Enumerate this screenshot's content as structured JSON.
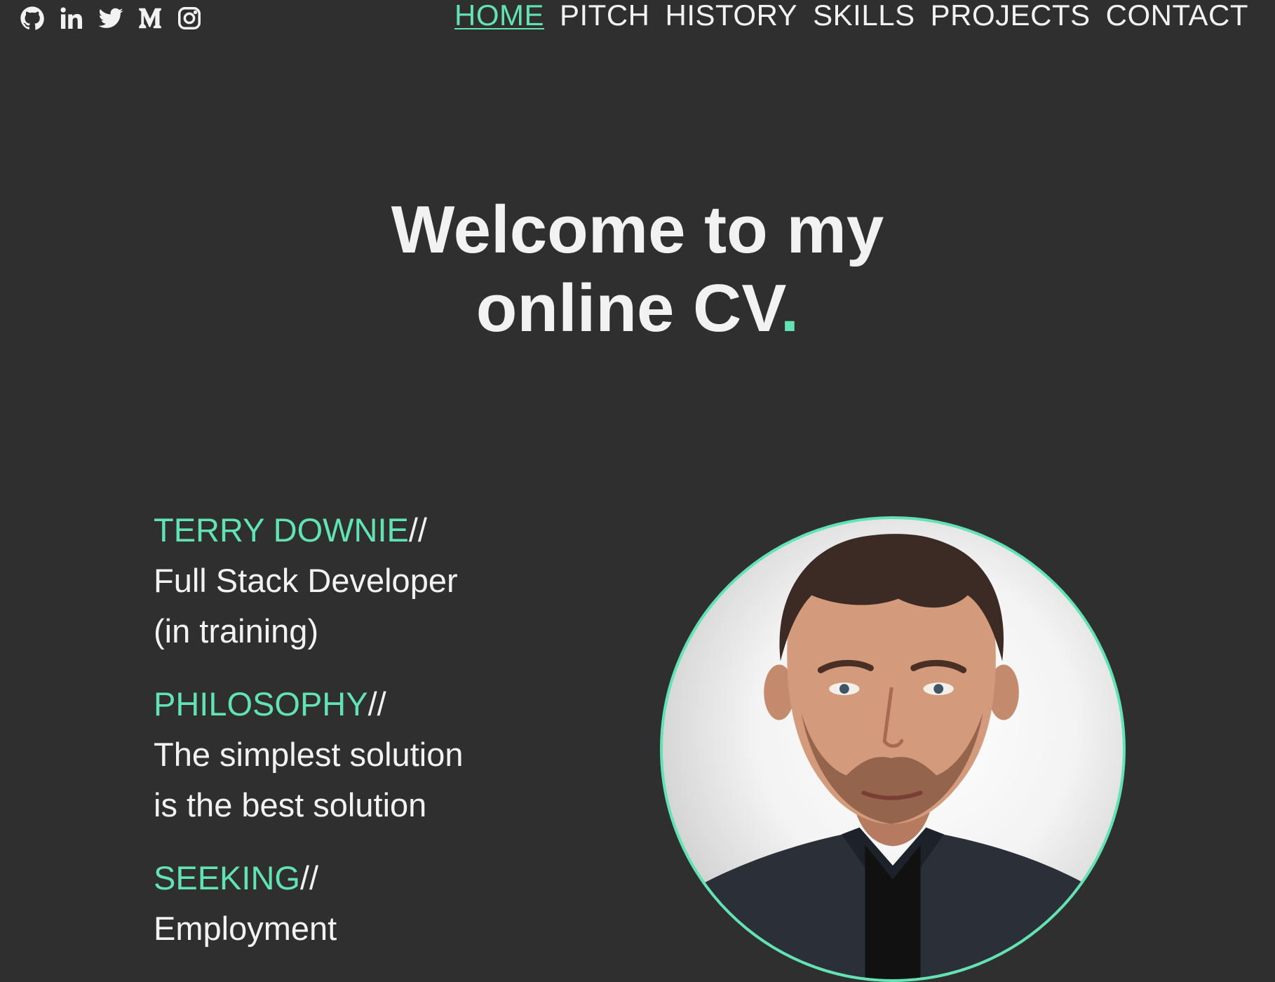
{
  "socials": [
    {
      "icon": "github-icon"
    },
    {
      "icon": "linkedin-icon"
    },
    {
      "icon": "twitter-icon"
    },
    {
      "icon": "medium-icon"
    },
    {
      "icon": "instagram-icon"
    }
  ],
  "nav": {
    "items": [
      {
        "label": "HOME",
        "active": true
      },
      {
        "label": "PITCH"
      },
      {
        "label": "HISTORY"
      },
      {
        "label": "SKILLS"
      },
      {
        "label": "PROJECTS"
      },
      {
        "label": "CONTACT"
      }
    ]
  },
  "hero": {
    "line1": "Welcome to my",
    "line2": "online CV",
    "dot": "."
  },
  "info": {
    "name": {
      "heading": "TERRY DOWNIE",
      "sep": "//",
      "line1": "Full Stack Developer",
      "line2": "(in training)"
    },
    "philosophy": {
      "heading": "PHILOSOPHY",
      "sep": "//",
      "line1": "The simplest solution",
      "line2": "is the best solution"
    },
    "seeking": {
      "heading": "SEEKING",
      "sep": "//",
      "line1": "Employment"
    }
  },
  "theme": {
    "background": "#2f2f2f",
    "accent": "#61e3b4",
    "text": "#f2f2f2"
  }
}
